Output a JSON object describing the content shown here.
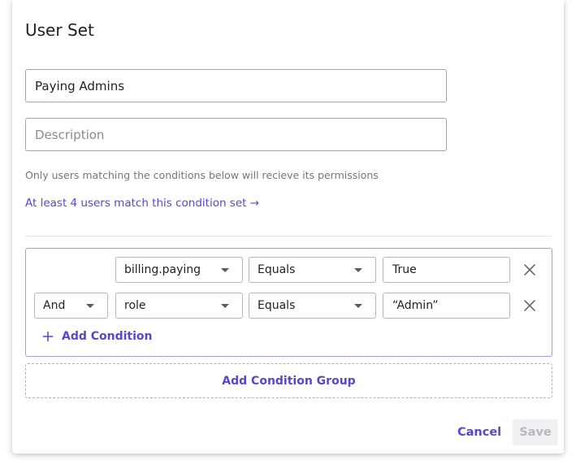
{
  "dialog": {
    "title": "User Set",
    "name_value": "Paying Admins",
    "description_placeholder": "Description",
    "helper_text": "Only users matching the conditions below will recieve its permissions",
    "match_link": "At least 4 users match this condition set →"
  },
  "conditions": [
    {
      "conjunction": "",
      "field": "billing.paying",
      "operator": "Equals",
      "value": "True"
    },
    {
      "conjunction": "And",
      "field": "role",
      "operator": "Equals",
      "value": "“Admin”"
    }
  ],
  "actions": {
    "add_condition": "Add Condition",
    "add_condition_group": "Add Condition Group",
    "cancel": "Cancel",
    "save": "Save",
    "save_enabled": false
  },
  "icons": {
    "remove": "close-icon",
    "add": "plus-icon",
    "dropdown": "caret-down-icon"
  },
  "colors": {
    "accent": "#5b45c9",
    "group_border": "#a69ce0",
    "text": "#1f1f29",
    "muted": "#75757d",
    "disabled_bg": "#f1f1f3",
    "disabled_text": "#b8b8be"
  }
}
